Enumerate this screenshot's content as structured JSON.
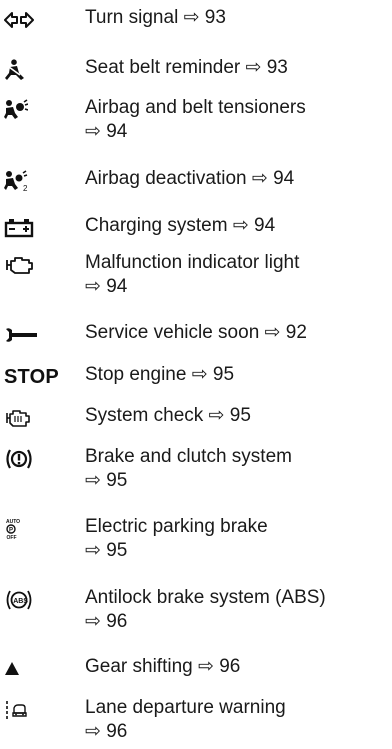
{
  "arrow_symbol": "⇨",
  "items": [
    {
      "icon": "turn-signal-icon",
      "text": "Turn signal",
      "ref": "93"
    },
    {
      "icon": "seat-belt-reminder-icon",
      "text": "Seat belt reminder",
      "ref": "93"
    },
    {
      "icon": "airbag-icon",
      "text": "Airbag and belt tensioners",
      "ref": "94"
    },
    {
      "icon": "airbag-deactivation-icon",
      "text": "Airbag deactivation",
      "ref": "94"
    },
    {
      "icon": "battery-icon",
      "text": "Charging system",
      "ref": "94"
    },
    {
      "icon": "engine-icon",
      "text": "Malfunction indicator light",
      "ref": "94"
    },
    {
      "icon": "wrench-icon",
      "text": "Service vehicle soon",
      "ref": "92"
    },
    {
      "icon": "stop-icon",
      "icon_text": "STOP",
      "text": "Stop engine",
      "ref": "95"
    },
    {
      "icon": "system-check-icon",
      "text": "System check",
      "ref": "95"
    },
    {
      "icon": "brake-warning-icon",
      "text": "Brake and clutch system",
      "ref": "95"
    },
    {
      "icon": "parking-brake-icon",
      "icon_text": "AUTO (P) OFF",
      "text": "Electric parking brake",
      "ref": "95"
    },
    {
      "icon": "abs-icon",
      "icon_text": "ABS",
      "text": "Antilock brake system (ABS)",
      "ref": "96"
    },
    {
      "icon": "gear-shift-triangle-icon",
      "text": "Gear shifting",
      "ref": "96"
    },
    {
      "icon": "lane-departure-icon",
      "text": "Lane departure warning",
      "ref": "96"
    }
  ]
}
